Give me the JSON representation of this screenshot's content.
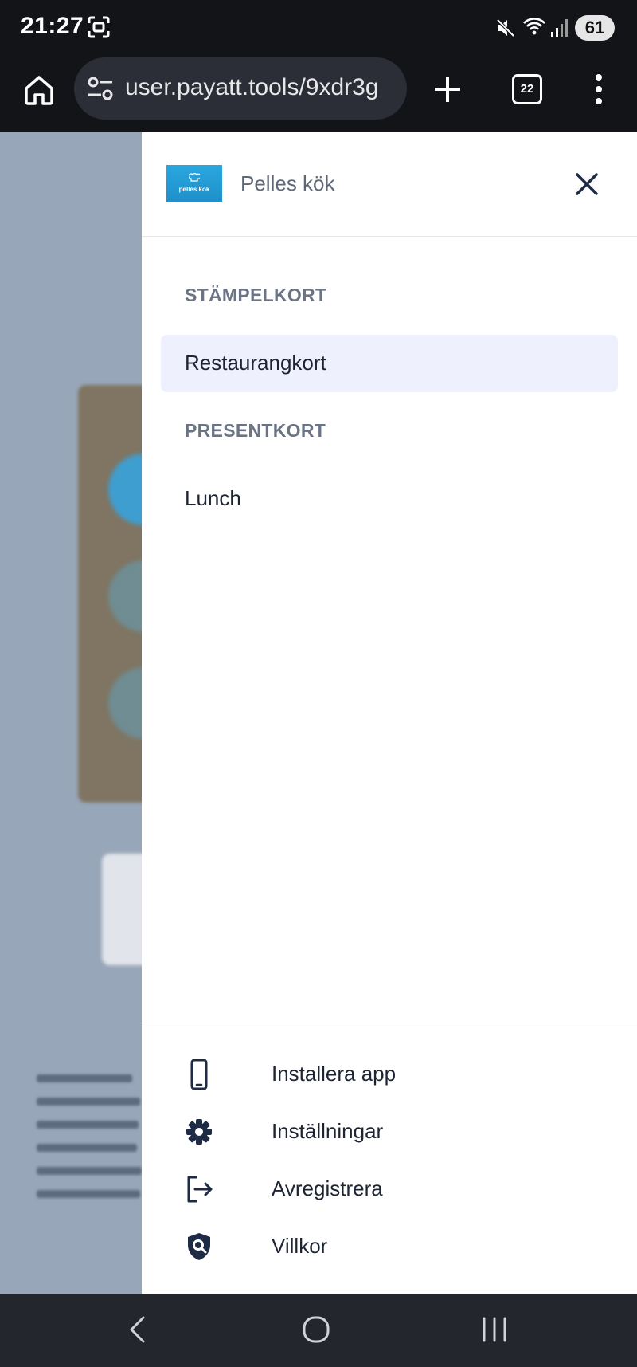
{
  "status_bar": {
    "time": "21:27",
    "battery": "61",
    "icons": [
      "screenshot-icon",
      "mute-icon",
      "wifi-icon",
      "signal-icon",
      "battery-icon"
    ]
  },
  "browser": {
    "url": "user.payatt.tools/9xdr3g",
    "tab_count": "22",
    "icons": [
      "home-icon",
      "site-settings-icon",
      "plus-icon",
      "tabs-icon",
      "more-vert-icon"
    ]
  },
  "drawer": {
    "logo_text": "pelles kök",
    "store_name": "Pelles kök",
    "sections": [
      {
        "label": "STÄMPELKORT",
        "items": [
          {
            "label": "Restaurangkort",
            "active": true
          }
        ]
      },
      {
        "label": "PRESENTKORT",
        "items": [
          {
            "label": "Lunch",
            "active": false
          }
        ]
      }
    ],
    "footer": [
      {
        "label": "Installera app",
        "icon": "phone-icon"
      },
      {
        "label": "Inställningar",
        "icon": "gear-icon"
      },
      {
        "label": "Avregistrera",
        "icon": "logout-icon"
      },
      {
        "label": "Villkor",
        "icon": "shield-search-icon"
      }
    ]
  },
  "colors": {
    "accent_active_bg": "#eef0fd",
    "section_label": "#6b7485",
    "logo_blue": "#2aa7df",
    "icon_dark": "#1e2b44"
  },
  "nav_bar": {
    "icons": [
      "back-icon",
      "home-circle-icon",
      "recents-icon"
    ]
  }
}
